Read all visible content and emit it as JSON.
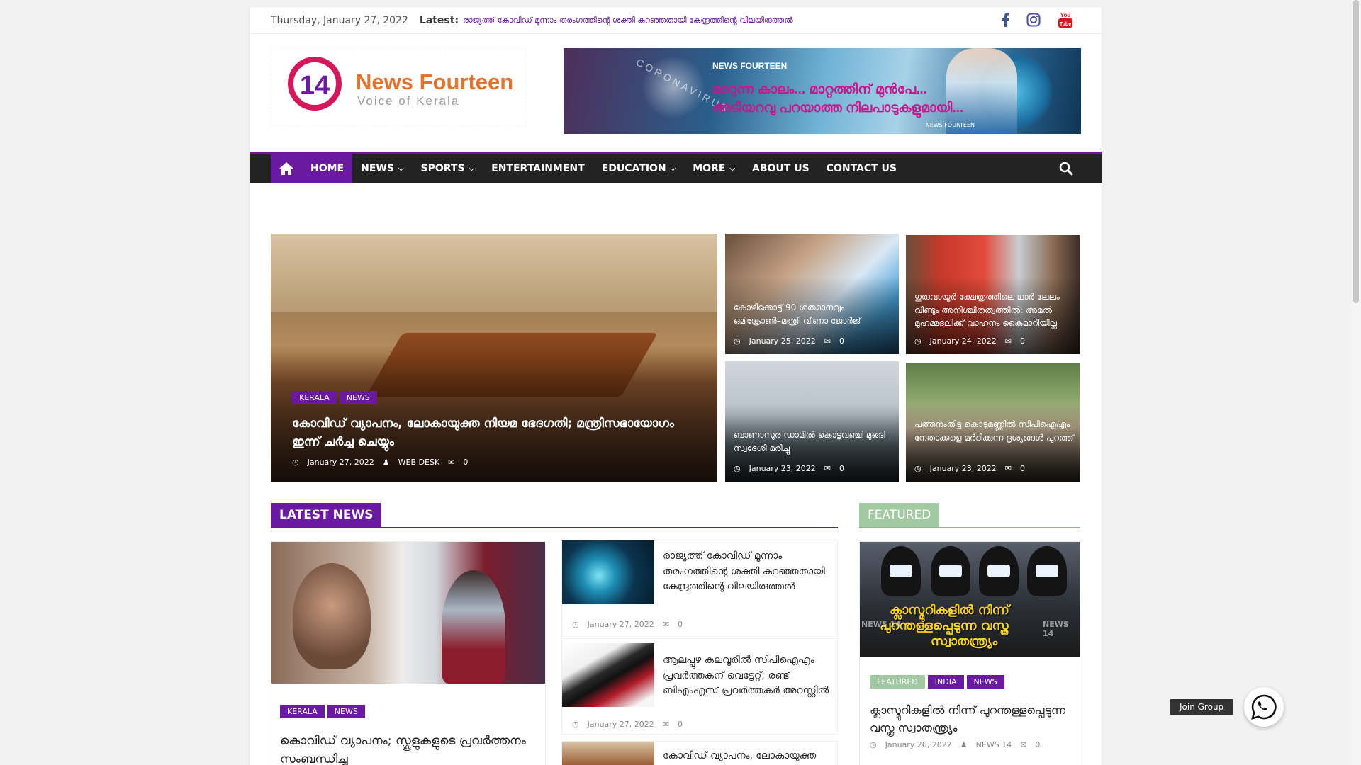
{
  "topbar": {
    "date": "Thursday, January 27, 2022",
    "latest_label": "Latest:",
    "latest_text": "രാജ്യത്ത് കോവിഡ് മൂന്നാം തരംഗത്തിന്റെ ശക്തി കുറഞ്ഞതായി കേന്ദ്രത്തിന്റെ വിലയിരുത്തൽ",
    "social": [
      "facebook-icon",
      "instagram-icon",
      "youtube-icon"
    ]
  },
  "header": {
    "logo_number": "14",
    "logo_title": "News Fourteen",
    "logo_tagline": "Voice of Kerala",
    "banner_brand": "NEWS FOURTEEN",
    "banner_line1": "മാറുന്ന കാലം... മാറ്റത്തിന് മുൻപേ...",
    "banner_line2": "അടിയറവു പറയാത്ത നിലപാടുകളുമായി...",
    "banner_corona": "CORONAVIRUS",
    "banner_small": "NEWS FOURTEEN"
  },
  "nav": {
    "items": [
      {
        "label": "HOME",
        "dropdown": false
      },
      {
        "label": "NEWS",
        "dropdown": true
      },
      {
        "label": "SPORTS",
        "dropdown": true
      },
      {
        "label": "ENTERTAINMENT",
        "dropdown": false
      },
      {
        "label": "EDUCATION",
        "dropdown": true
      },
      {
        "label": "MORE",
        "dropdown": true
      },
      {
        "label": "ABOUT US",
        "dropdown": false
      },
      {
        "label": "CONTACT US",
        "dropdown": false
      }
    ]
  },
  "hero": {
    "main": {
      "tags": [
        "KERALA",
        "NEWS"
      ],
      "title": "കോവിഡ് വ്യാപനം, ലോകായുക്ത നിയമ ഭേദഗതി; മന്ത്രിസഭായോഗം ഇന്ന് ചർച്ച ചെയ്യും",
      "date": "January 27, 2022",
      "author": "WEB DESK",
      "comments": "0"
    },
    "small": [
      {
        "title": "കോഴിക്കോട്ട് 90 ശതമാനവും ഒമിക്രോൺ–മന്ത്രി വീണാ ജോർജ്",
        "date": "January 25, 2022",
        "comments": "0"
      },
      {
        "title": "ഗുരുവായൂർ ക്ഷേത്രത്തിലെ ഥാർ ലേലം വീണ്ടും അനിശ്ചിതത്വത്തിൽ: അമൽ മുഹമ്മദലിക്ക് വാഹനം കൈമാറിയില്ല",
        "date": "January 24, 2022",
        "comments": "0"
      },
      {
        "title": "ബാണാസുര ഡാമിൽ കൊട്ടവഞ്ചി മുങ്ങി സ്വദേശി മരിച്ചു",
        "date": "January 23, 2022",
        "comments": "0"
      },
      {
        "title": "പത്തനംതിട്ട കൊടുമണ്ണിൽ സിപിഐഎം നേതാക്കളെ മർദിക്കുന്ന ദൃശ്യങ്ങൾ പുറത്ത്",
        "date": "January 23, 2022",
        "comments": "0"
      }
    ]
  },
  "latest": {
    "heading": "LATEST NEWS",
    "main": {
      "tags": [
        "KERALA",
        "NEWS"
      ],
      "title": "കൊവിഡ് വ്യാപനം; സ്കൂളുകളുടെ പ്രവർത്തനം സംബന്ധിച്ച"
    },
    "list": [
      {
        "title": "രാജ്യത്ത് കോവിഡ് മൂന്നാം തരംഗത്തിന്റെ ശക്തി കുറഞ്ഞതായി കേന്ദ്രത്തിന്റെ വിലയിരുത്തൽ",
        "date": "January 27, 2022",
        "comments": "0"
      },
      {
        "title": "ആലപ്പുഴ കലവൂരിൽ സിപിഐഎം പ്രവർത്തകന് വെട്ടേറ്റ്; രണ്ട് ബിഎംഎസ് പ്രവർത്തകർ അറസ്റ്റിൽ",
        "date": "January 27, 2022",
        "comments": "0"
      },
      {
        "title": "കോവിഡ് വ്യാപനം, ലോകായുക്ത",
        "date": "",
        "comments": ""
      }
    ]
  },
  "featured": {
    "heading": "FEATURED",
    "tags": [
      "FEATURED",
      "INDIA",
      "NEWS"
    ],
    "img_text1": "ക്ലാസ്മുറികളിൽ നിന്ന്",
    "img_text2": "പുറന്തള്ളപ്പെടുന്ന വസ്ത്ര",
    "img_text3": "സ്വാതന്ത്ര്യം",
    "img_watermark": "NEWS 14",
    "title": "ക്ലാസ്മുറികളിൽ നിന്ന് പുറന്തള്ളപ്പെടുന്ന വസ്ത്ര സ്വാതന്ത്ര്യം",
    "date": "January 26, 2022",
    "author": "NEWS 14",
    "comments": "0"
  },
  "whatsapp": {
    "join_label": "Join Group"
  },
  "colors": {
    "accent": "#6a1aa1",
    "nav_bg": "#232323",
    "featured": "#a3c9a3"
  }
}
